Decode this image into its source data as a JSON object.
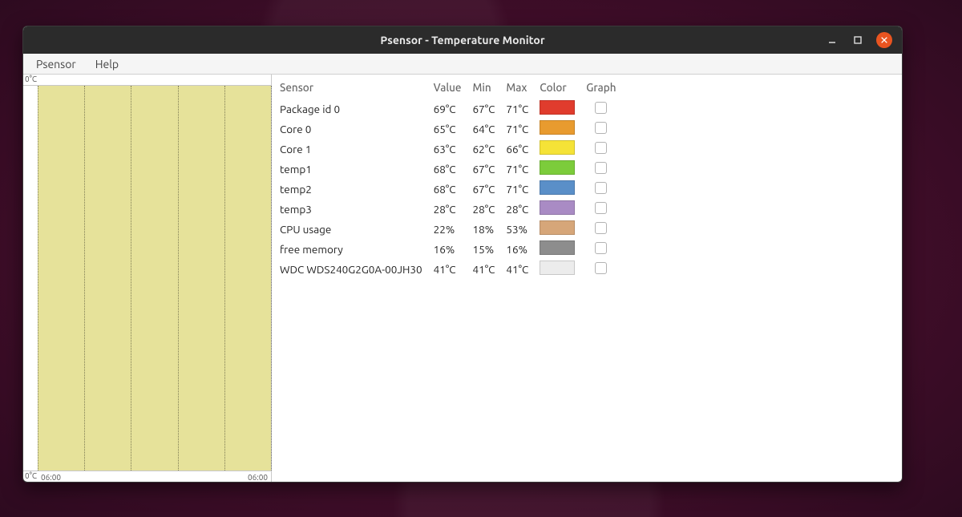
{
  "window": {
    "title": "Psensor - Temperature Monitor"
  },
  "menu": {
    "items": [
      "Psensor",
      "Help"
    ]
  },
  "graph": {
    "y_top": "0°C",
    "y_bottom": "0°C",
    "x_left": "06:00",
    "x_right": "06:00"
  },
  "columns": {
    "sensor": "Sensor",
    "value": "Value",
    "min": "Min",
    "max": "Max",
    "color": "Color",
    "graph": "Graph"
  },
  "sensors": [
    {
      "name": "Package id 0",
      "value": "69°C",
      "min": "67°C",
      "max": "71°C",
      "color": "#e03c2d"
    },
    {
      "name": "Core 0",
      "value": "65°C",
      "min": "64°C",
      "max": "71°C",
      "color": "#e89b2f"
    },
    {
      "name": "Core 1",
      "value": "63°C",
      "min": "62°C",
      "max": "66°C",
      "color": "#f5e337"
    },
    {
      "name": "temp1",
      "value": "68°C",
      "min": "67°C",
      "max": "71°C",
      "color": "#7ccc3b"
    },
    {
      "name": "temp2",
      "value": "68°C",
      "min": "67°C",
      "max": "71°C",
      "color": "#5a8fc8"
    },
    {
      "name": "temp3",
      "value": "28°C",
      "min": "28°C",
      "max": "28°C",
      "color": "#a98bc4"
    },
    {
      "name": "CPU usage",
      "value": "22%",
      "min": "18%",
      "max": "53%",
      "color": "#d6a679"
    },
    {
      "name": "free memory",
      "value": "16%",
      "min": "15%",
      "max": "16%",
      "color": "#8d8d8d"
    },
    {
      "name": "WDC WDS240G2G0A-00JH30",
      "value": "41°C",
      "min": "41°C",
      "max": "41°C",
      "color": "#ececec"
    }
  ],
  "chart_data": {
    "type": "line",
    "title": "",
    "xlabel": "",
    "ylabel": "",
    "x_range": [
      "06:00",
      "06:00"
    ],
    "y_range": [
      0,
      0
    ],
    "series": [],
    "note": "Graph area is empty; no plotted series visible."
  }
}
